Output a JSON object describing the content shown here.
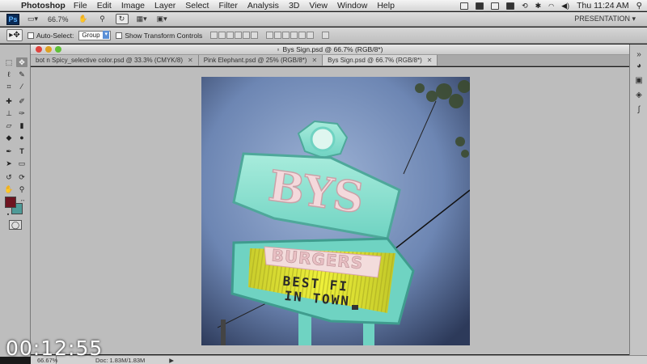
{
  "menubar": {
    "app_name": "Photoshop",
    "menus": [
      "File",
      "Edit",
      "Image",
      "Layer",
      "Select",
      "Filter",
      "Analysis",
      "3D",
      "View",
      "Window",
      "Help"
    ],
    "clock": "Thu 11:24 AM"
  },
  "appbar": {
    "logo_text": "Ps",
    "zoom": "66.7%",
    "workspace": "PRESENTATION"
  },
  "options": {
    "auto_select_label": "Auto-Select:",
    "auto_select_value": "Group",
    "show_transform_label": "Show Transform Controls"
  },
  "document": {
    "title": "Bys Sign.psd @ 66.7% (RGB/8*)",
    "tabs": [
      {
        "label": "bot n Spicy_selective color.psd @ 33.3% (CMYK/8)"
      },
      {
        "label": "Pink Elephant.psd @ 25% (RGB/8*)"
      },
      {
        "label": "Bys Sign.psd @ 66.7% (RGB/8*)"
      }
    ]
  },
  "colors": {
    "foreground": "#6e1420",
    "background": "#4f9b98"
  },
  "sign": {
    "top_text": "BYS",
    "lower_title": "BURGERS",
    "line1": "BEST FI",
    "line2": "IN TOWN"
  },
  "status": {
    "zoom": "66.67%",
    "doc": "Doc: 1.83M/1.83M"
  },
  "overlay": {
    "timecode": "00:12:55"
  }
}
